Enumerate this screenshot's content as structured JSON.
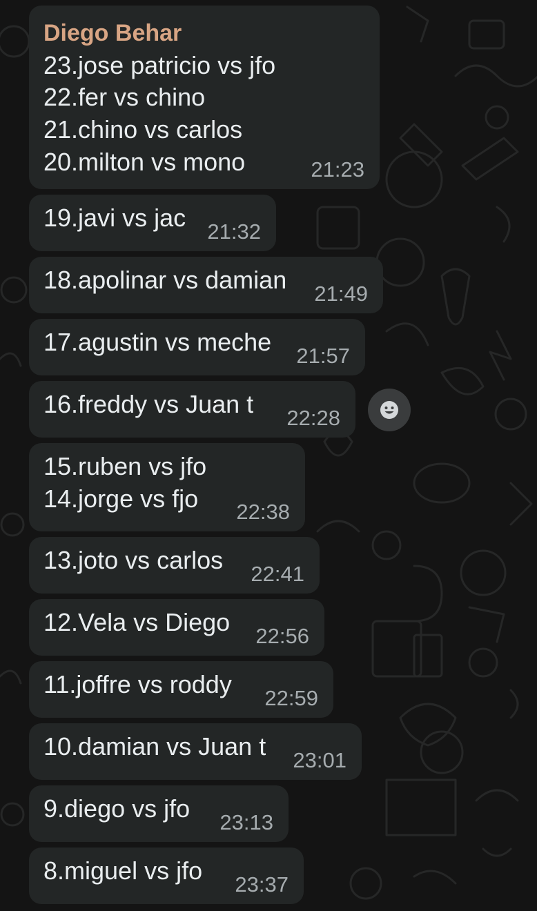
{
  "chat": {
    "first_message": {
      "sender": "Diego Behar",
      "lines": [
        "23.jose patricio vs jfo",
        "22.fer vs chino",
        "21.chino vs carlos",
        "20.milton vs mono"
      ],
      "time": "21:23"
    },
    "messages": [
      {
        "lines": [
          "19.javi vs jac"
        ],
        "time": "21:32"
      },
      {
        "lines": [
          "18.apolinar vs damian"
        ],
        "time": "21:49"
      },
      {
        "lines": [
          "17.agustin vs meche"
        ],
        "time": "21:57"
      },
      {
        "lines": [
          "16.freddy vs Juan t"
        ],
        "time": "22:28"
      },
      {
        "lines": [
          "15.ruben vs jfo",
          "14.jorge vs fjo"
        ],
        "time": "22:38"
      },
      {
        "lines": [
          "13.joto vs carlos"
        ],
        "time": "22:41"
      },
      {
        "lines": [
          "12.Vela vs Diego"
        ],
        "time": "22:56"
      },
      {
        "lines": [
          "11.joffre vs roddy"
        ],
        "time": "22:59"
      },
      {
        "lines": [
          "10.damian vs Juan t"
        ],
        "time": "23:01"
      },
      {
        "lines": [
          "9.diego vs jfo"
        ],
        "time": "23:13"
      },
      {
        "lines": [
          "8.miguel vs jfo"
        ],
        "time": "23:37"
      }
    ],
    "reaction_button": {
      "icon": "smiley-icon"
    },
    "colors": {
      "background": "#141414",
      "bubble": "#232626",
      "sender_name": "#d8a584",
      "message_text": "#e9edef",
      "timestamp": "#a6acaf"
    }
  }
}
